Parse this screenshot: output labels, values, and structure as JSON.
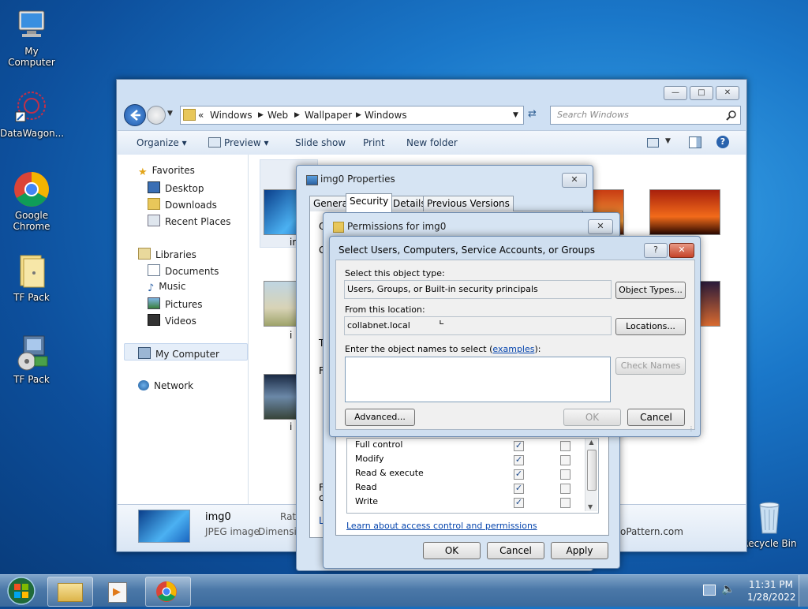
{
  "desktop": {
    "icons": [
      {
        "label": "My Computer"
      },
      {
        "label": "DataWagon..."
      },
      {
        "label": "Google Chrome"
      },
      {
        "label": "TF Pack"
      },
      {
        "label": "TF Pack"
      },
      {
        "label": "Recycle Bin"
      }
    ]
  },
  "explorer": {
    "breadcrumb_chevrons": "«",
    "breadcrumb": [
      "Windows",
      "Web",
      "Wallpaper",
      "Windows"
    ],
    "search_placeholder": "Search Windows",
    "toolbar": {
      "organize": "Organize",
      "preview": "Preview",
      "slideshow": "Slide show",
      "print": "Print",
      "new_folder": "New folder"
    },
    "nav": {
      "favorites": "Favorites",
      "desktop": "Desktop",
      "downloads": "Downloads",
      "recent": "Recent Places",
      "libraries": "Libraries",
      "documents": "Documents",
      "music": "Music",
      "pictures": "Pictures",
      "videos": "Videos",
      "my_computer": "My Computer",
      "network": "Network"
    },
    "thumb_labels": [
      "im",
      "i",
      "i"
    ],
    "status": {
      "name": "img0",
      "type": "JPEG image",
      "rating": "Rati",
      "dimensions": "Dimensio",
      "tail": "oPattern.com"
    }
  },
  "properties": {
    "title": "img0 Properties",
    "tabs": [
      "General",
      "Security",
      "Details",
      "Previous Versions"
    ],
    "side_letters": [
      "O",
      "G",
      "T",
      "F",
      "F",
      "c",
      "L"
    ],
    "buttons": {
      "ok": "OK",
      "cancel": "Cancel",
      "apply": "Apply"
    }
  },
  "permissions": {
    "title": "Permissions for img0",
    "rows": [
      {
        "label": "Full control",
        "allow": true,
        "deny": false
      },
      {
        "label": "Modify",
        "allow": true,
        "deny": false
      },
      {
        "label": "Read & execute",
        "allow": true,
        "deny": false
      },
      {
        "label": "Read",
        "allow": true,
        "deny": false
      },
      {
        "label": "Write",
        "allow": true,
        "deny": false
      }
    ],
    "learn_link": "Learn about access control and permissions",
    "buttons": {
      "ok": "OK",
      "cancel": "Cancel",
      "apply": "Apply"
    }
  },
  "select_dialog": {
    "title": "Select Users, Computers, Service Accounts, or Groups",
    "object_type_label": "Select this object type:",
    "object_type_value": "Users, Groups, or Built-in security principals",
    "object_types_btn": "Object Types...",
    "location_label": "From this location:",
    "location_value": "collabnet.local",
    "locations_btn": "Locations...",
    "names_label_prefix": "Enter the object names to select (",
    "names_label_link": "examples",
    "names_label_suffix": "):",
    "names_value": "",
    "check_names_btn": "Check Names",
    "advanced_btn": "Advanced...",
    "ok_btn": "OK",
    "cancel_btn": "Cancel",
    "help_btn": "?"
  },
  "taskbar": {
    "time": "11:31 PM",
    "date": "1/28/2022"
  },
  "colors": {
    "link": "#0645ad",
    "desktop": "#1a77c9"
  }
}
